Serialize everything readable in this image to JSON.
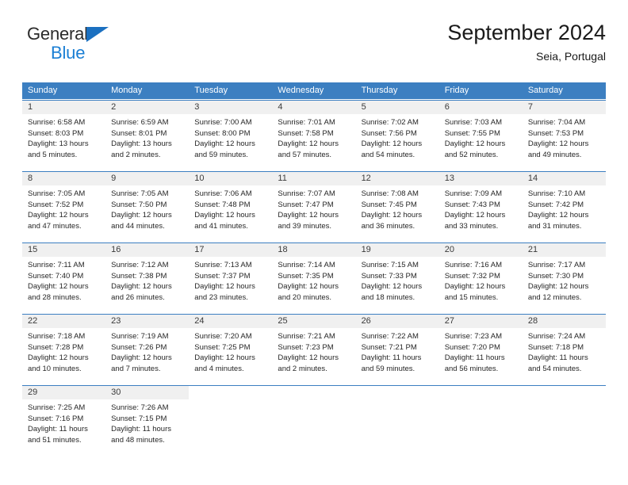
{
  "brand": {
    "line1": "General",
    "line2": "Blue",
    "triangle_color": "#1b70c0",
    "blue_color": "#1b7fd4"
  },
  "header": {
    "title": "September 2024",
    "subtitle": "Seia, Portugal"
  },
  "colors": {
    "header_blue": "#3c7fc1",
    "daynum_gray": "#f0f0f0",
    "text": "#262626"
  },
  "weekdays": [
    "Sunday",
    "Monday",
    "Tuesday",
    "Wednesday",
    "Thursday",
    "Friday",
    "Saturday"
  ],
  "weeks": [
    [
      {
        "num": "1",
        "sunrise": "Sunrise: 6:58 AM",
        "sunset": "Sunset: 8:03 PM",
        "daylight1": "Daylight: 13 hours",
        "daylight2": "and 5 minutes."
      },
      {
        "num": "2",
        "sunrise": "Sunrise: 6:59 AM",
        "sunset": "Sunset: 8:01 PM",
        "daylight1": "Daylight: 13 hours",
        "daylight2": "and 2 minutes."
      },
      {
        "num": "3",
        "sunrise": "Sunrise: 7:00 AM",
        "sunset": "Sunset: 8:00 PM",
        "daylight1": "Daylight: 12 hours",
        "daylight2": "and 59 minutes."
      },
      {
        "num": "4",
        "sunrise": "Sunrise: 7:01 AM",
        "sunset": "Sunset: 7:58 PM",
        "daylight1": "Daylight: 12 hours",
        "daylight2": "and 57 minutes."
      },
      {
        "num": "5",
        "sunrise": "Sunrise: 7:02 AM",
        "sunset": "Sunset: 7:56 PM",
        "daylight1": "Daylight: 12 hours",
        "daylight2": "and 54 minutes."
      },
      {
        "num": "6",
        "sunrise": "Sunrise: 7:03 AM",
        "sunset": "Sunset: 7:55 PM",
        "daylight1": "Daylight: 12 hours",
        "daylight2": "and 52 minutes."
      },
      {
        "num": "7",
        "sunrise": "Sunrise: 7:04 AM",
        "sunset": "Sunset: 7:53 PM",
        "daylight1": "Daylight: 12 hours",
        "daylight2": "and 49 minutes."
      }
    ],
    [
      {
        "num": "8",
        "sunrise": "Sunrise: 7:05 AM",
        "sunset": "Sunset: 7:52 PM",
        "daylight1": "Daylight: 12 hours",
        "daylight2": "and 47 minutes."
      },
      {
        "num": "9",
        "sunrise": "Sunrise: 7:05 AM",
        "sunset": "Sunset: 7:50 PM",
        "daylight1": "Daylight: 12 hours",
        "daylight2": "and 44 minutes."
      },
      {
        "num": "10",
        "sunrise": "Sunrise: 7:06 AM",
        "sunset": "Sunset: 7:48 PM",
        "daylight1": "Daylight: 12 hours",
        "daylight2": "and 41 minutes."
      },
      {
        "num": "11",
        "sunrise": "Sunrise: 7:07 AM",
        "sunset": "Sunset: 7:47 PM",
        "daylight1": "Daylight: 12 hours",
        "daylight2": "and 39 minutes."
      },
      {
        "num": "12",
        "sunrise": "Sunrise: 7:08 AM",
        "sunset": "Sunset: 7:45 PM",
        "daylight1": "Daylight: 12 hours",
        "daylight2": "and 36 minutes."
      },
      {
        "num": "13",
        "sunrise": "Sunrise: 7:09 AM",
        "sunset": "Sunset: 7:43 PM",
        "daylight1": "Daylight: 12 hours",
        "daylight2": "and 33 minutes."
      },
      {
        "num": "14",
        "sunrise": "Sunrise: 7:10 AM",
        "sunset": "Sunset: 7:42 PM",
        "daylight1": "Daylight: 12 hours",
        "daylight2": "and 31 minutes."
      }
    ],
    [
      {
        "num": "15",
        "sunrise": "Sunrise: 7:11 AM",
        "sunset": "Sunset: 7:40 PM",
        "daylight1": "Daylight: 12 hours",
        "daylight2": "and 28 minutes."
      },
      {
        "num": "16",
        "sunrise": "Sunrise: 7:12 AM",
        "sunset": "Sunset: 7:38 PM",
        "daylight1": "Daylight: 12 hours",
        "daylight2": "and 26 minutes."
      },
      {
        "num": "17",
        "sunrise": "Sunrise: 7:13 AM",
        "sunset": "Sunset: 7:37 PM",
        "daylight1": "Daylight: 12 hours",
        "daylight2": "and 23 minutes."
      },
      {
        "num": "18",
        "sunrise": "Sunrise: 7:14 AM",
        "sunset": "Sunset: 7:35 PM",
        "daylight1": "Daylight: 12 hours",
        "daylight2": "and 20 minutes."
      },
      {
        "num": "19",
        "sunrise": "Sunrise: 7:15 AM",
        "sunset": "Sunset: 7:33 PM",
        "daylight1": "Daylight: 12 hours",
        "daylight2": "and 18 minutes."
      },
      {
        "num": "20",
        "sunrise": "Sunrise: 7:16 AM",
        "sunset": "Sunset: 7:32 PM",
        "daylight1": "Daylight: 12 hours",
        "daylight2": "and 15 minutes."
      },
      {
        "num": "21",
        "sunrise": "Sunrise: 7:17 AM",
        "sunset": "Sunset: 7:30 PM",
        "daylight1": "Daylight: 12 hours",
        "daylight2": "and 12 minutes."
      }
    ],
    [
      {
        "num": "22",
        "sunrise": "Sunrise: 7:18 AM",
        "sunset": "Sunset: 7:28 PM",
        "daylight1": "Daylight: 12 hours",
        "daylight2": "and 10 minutes."
      },
      {
        "num": "23",
        "sunrise": "Sunrise: 7:19 AM",
        "sunset": "Sunset: 7:26 PM",
        "daylight1": "Daylight: 12 hours",
        "daylight2": "and 7 minutes."
      },
      {
        "num": "24",
        "sunrise": "Sunrise: 7:20 AM",
        "sunset": "Sunset: 7:25 PM",
        "daylight1": "Daylight: 12 hours",
        "daylight2": "and 4 minutes."
      },
      {
        "num": "25",
        "sunrise": "Sunrise: 7:21 AM",
        "sunset": "Sunset: 7:23 PM",
        "daylight1": "Daylight: 12 hours",
        "daylight2": "and 2 minutes."
      },
      {
        "num": "26",
        "sunrise": "Sunrise: 7:22 AM",
        "sunset": "Sunset: 7:21 PM",
        "daylight1": "Daylight: 11 hours",
        "daylight2": "and 59 minutes."
      },
      {
        "num": "27",
        "sunrise": "Sunrise: 7:23 AM",
        "sunset": "Sunset: 7:20 PM",
        "daylight1": "Daylight: 11 hours",
        "daylight2": "and 56 minutes."
      },
      {
        "num": "28",
        "sunrise": "Sunrise: 7:24 AM",
        "sunset": "Sunset: 7:18 PM",
        "daylight1": "Daylight: 11 hours",
        "daylight2": "and 54 minutes."
      }
    ],
    [
      {
        "num": "29",
        "sunrise": "Sunrise: 7:25 AM",
        "sunset": "Sunset: 7:16 PM",
        "daylight1": "Daylight: 11 hours",
        "daylight2": "and 51 minutes."
      },
      {
        "num": "30",
        "sunrise": "Sunrise: 7:26 AM",
        "sunset": "Sunset: 7:15 PM",
        "daylight1": "Daylight: 11 hours",
        "daylight2": "and 48 minutes."
      },
      {
        "num": "",
        "sunrise": "",
        "sunset": "",
        "daylight1": "",
        "daylight2": ""
      },
      {
        "num": "",
        "sunrise": "",
        "sunset": "",
        "daylight1": "",
        "daylight2": ""
      },
      {
        "num": "",
        "sunrise": "",
        "sunset": "",
        "daylight1": "",
        "daylight2": ""
      },
      {
        "num": "",
        "sunrise": "",
        "sunset": "",
        "daylight1": "",
        "daylight2": ""
      },
      {
        "num": "",
        "sunrise": "",
        "sunset": "",
        "daylight1": "",
        "daylight2": ""
      }
    ]
  ]
}
